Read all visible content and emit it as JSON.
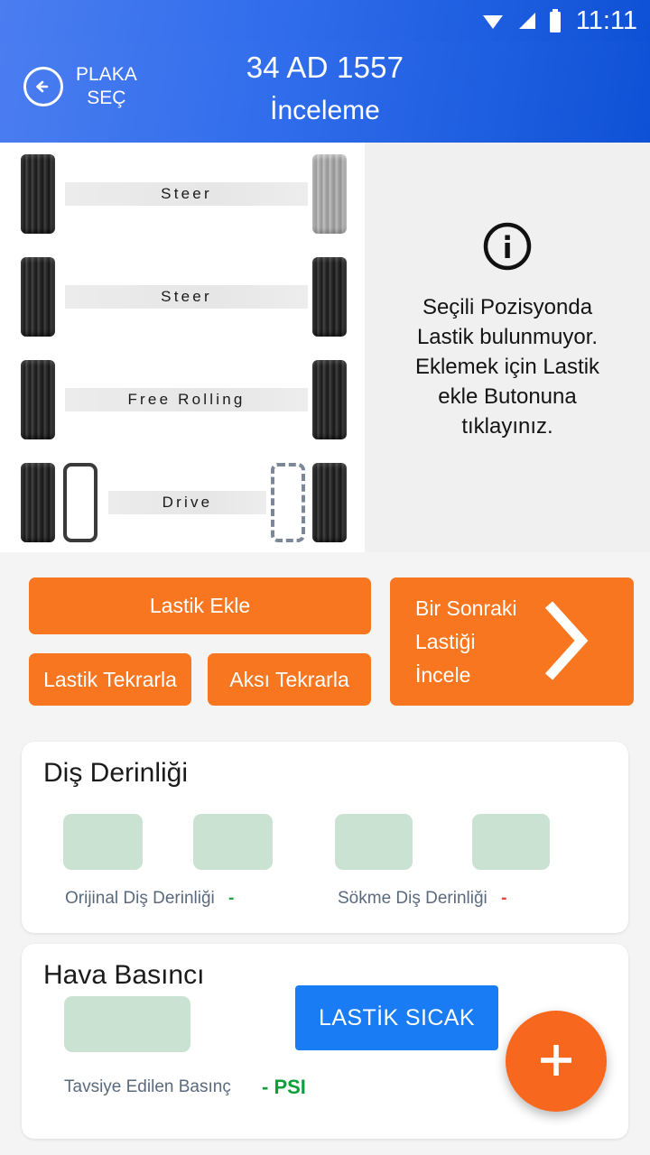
{
  "statusbar": {
    "clock": "11:11",
    "icons": [
      "wifi-icon",
      "cellular-signal-icon",
      "battery-icon"
    ]
  },
  "appbar": {
    "back_icon": "arrow-left-icon",
    "back_label": "PLAKA\nSEÇ",
    "plate": "34 AD 1557",
    "subtitle": "İnceleme"
  },
  "diagram": {
    "axles": [
      {
        "label": "Steer",
        "left_tire": "tire-dark",
        "right_tire": "tire-light-selected"
      },
      {
        "label": "Steer",
        "left_tire": "tire-dark",
        "right_tire": "tire-dark"
      },
      {
        "label": "Free Rolling",
        "left_tire": "tire-dark",
        "right_tire": "tire-dark"
      },
      {
        "label": "Drive",
        "left_tire": "tire-dark",
        "right_tire": "tire-dark"
      }
    ]
  },
  "info": {
    "icon": "info-circle-icon",
    "message": "Seçili Pozisyonda Lastik bulunmuyor. Eklemek için Lastik ekle Butonuna tıklayınız."
  },
  "buttons": {
    "add_tire": "Lastik Ekle",
    "repeat_tire": "Lastik Tekrarla",
    "repeat_axle": "Aksı Tekrarla",
    "next_tire": "Bir Sonraki\nLastiği\nİncele",
    "next_icon": "chevron-right-icon"
  },
  "tread_card": {
    "title": "Diş Derinliği",
    "inputs": [
      "",
      "",
      "",
      ""
    ],
    "original_label": "Orijinal Diş Derinliği",
    "original_value": "-",
    "removal_label": "Sökme Diş Derinliği",
    "removal_value": "-"
  },
  "pressure_card": {
    "title": "Hava Basıncı",
    "input": "",
    "hot_button": "LASTİK SICAK",
    "recommended_label": "Tavsiye Edilen Basınç",
    "recommended_value": "- PSI"
  },
  "fab": {
    "icon": "plus-icon"
  },
  "colors": {
    "header_blue_light": "#4b7df0",
    "header_blue_dark": "#0f51d6",
    "accent_orange": "#f7761f",
    "fab_orange": "#f7671d",
    "hot_blue": "#1a7cf5",
    "input_green": "#c9e2d2",
    "value_green": "#0da03a",
    "value_red": "#f0403a",
    "label_gray": "#5a6a7d",
    "page_bg": "#f4f4f4",
    "info_panel_bg": "#f0f0f0"
  }
}
